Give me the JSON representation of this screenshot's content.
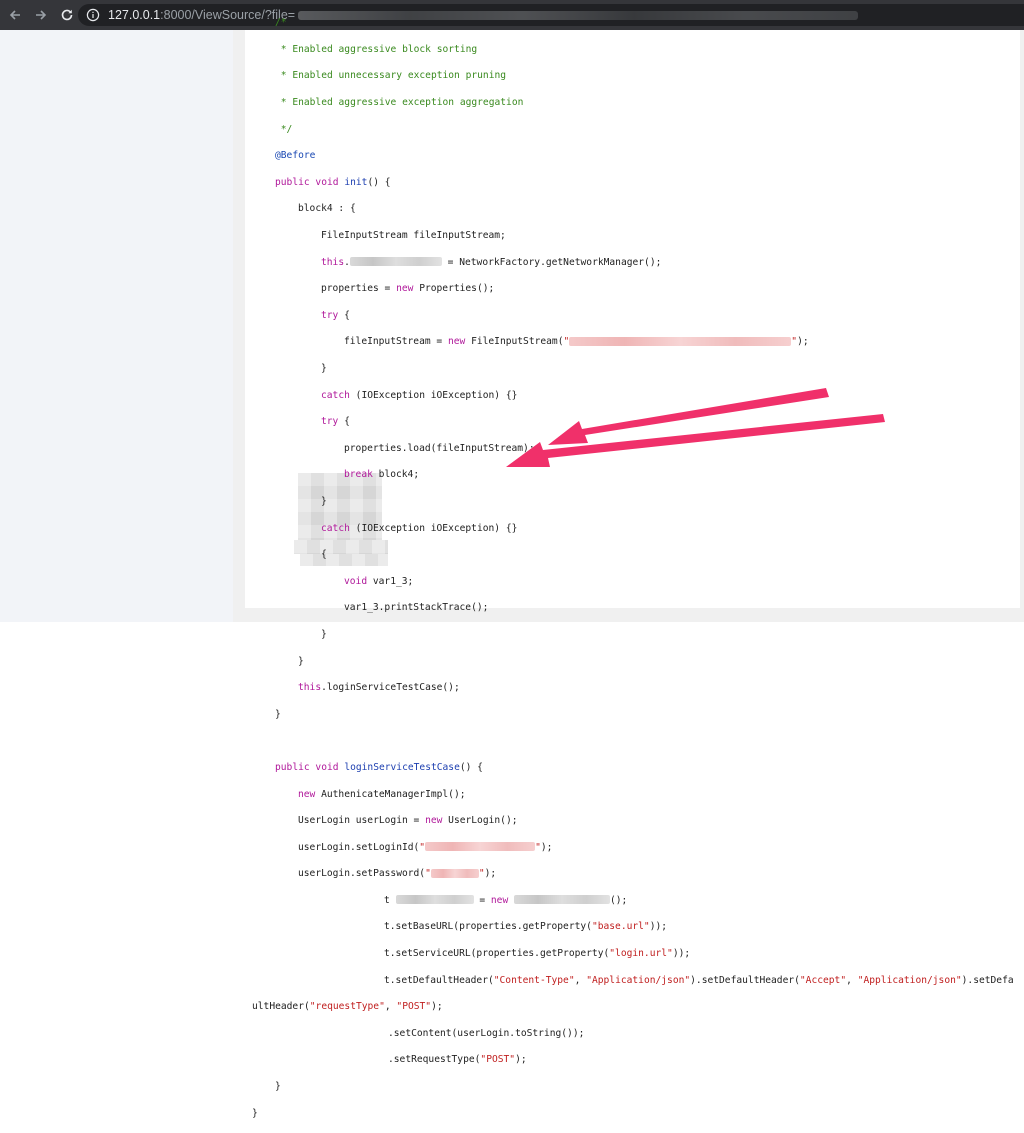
{
  "browser": {
    "url_host": "127.0.0.1",
    "url_rest": ":8000/ViewSource/?file=",
    "icons": [
      "back-arrow-icon",
      "forward-arrow-icon",
      "reload-icon",
      "info-icon"
    ]
  },
  "code": {
    "comment_open": "/*",
    "comment_1": " * Enabled aggressive block sorting",
    "comment_2": " * Enabled unnecessary exception pruning",
    "comment_3": " * Enabled aggressive exception aggregation",
    "comment_close": " */",
    "annotation": "@Before",
    "l_init_pub": "public void",
    "l_init_name": "init",
    "l_init_tail": "() {",
    "l_block4": "block4 : {",
    "l_fis_decl": "FileInputStream fileInputStream;",
    "l_this": "this",
    "l_netmgr_tail": " = NetworkFactory.getNetworkManager();",
    "l_props_a": "properties = ",
    "l_new": "new",
    "l_props_b": " Properties();",
    "l_try": "try",
    "l_brace_open": " {",
    "l_fis_assign_a": "fileInputStream = ",
    "l_fis_assign_b": " FileInputStream(",
    "l_quote": "\"",
    "l_fis_tail": ");",
    "l_close": "}",
    "l_catch": "catch",
    "l_catch_tail": " (IOException iOException) {}",
    "l_props_load": "properties.load(fileInputStream);",
    "l_break": "break",
    "l_break_tail": " block4;",
    "l_open": "{",
    "l_void": "void",
    "l_var_decl": " var1_3;",
    "l_print": "var1_3.printStackTrace();",
    "l_this_login_tail": ".loginServiceTestCase();",
    "l_login_name": "loginServiceTestCase",
    "l_authmgr_tail": " AuthenicateManagerImpl();",
    "l_userlogin_a": "UserLogin userLogin = ",
    "l_userlogin_b": " UserLogin();",
    "l_setid": "userLogin.setLoginId(",
    "l_setpw": "userLogin.setPassword(",
    "l_close_paren": ");",
    "l_t": "t",
    "l_eq": " = ",
    "l_semi": "();",
    "l_baseurl_a": "t.setBaseURL(properties.getProperty(",
    "l_baseurl_s": "\"base.url\"",
    "l_getprop_tail": "));",
    "l_svcurl_a": "t.setServiceURL(properties.getProperty(",
    "l_svcurl_s": "\"login.url\"",
    "l_hdr_a": "t.setDefaultHeader(",
    "l_hdr_s1": "\"Content-Type\"",
    "l_comma": ", ",
    "l_hdr_s2": "\"Application/json\"",
    "l_hdr_b": ").setDefaultHeader(",
    "l_hdr_s3": "\"Accept\"",
    "l_hdr_c": ").setDefa",
    "l_wrap_a": "ultHeader(",
    "l_wrap_s1": "\"requestType\"",
    "l_wrap_s2": "\"POST\"",
    "l_content": ".setContent(userLogin.toString());",
    "l_reqtype_a": ".setRequestType(",
    "l_final_close": "}"
  },
  "colors": {
    "comment": "#3a8a1f",
    "keyword": "#b0189a",
    "annotation": "#1a48b3",
    "method": "#1d3fb0",
    "string": "#c01f1f",
    "arrow": "#f0306a"
  }
}
